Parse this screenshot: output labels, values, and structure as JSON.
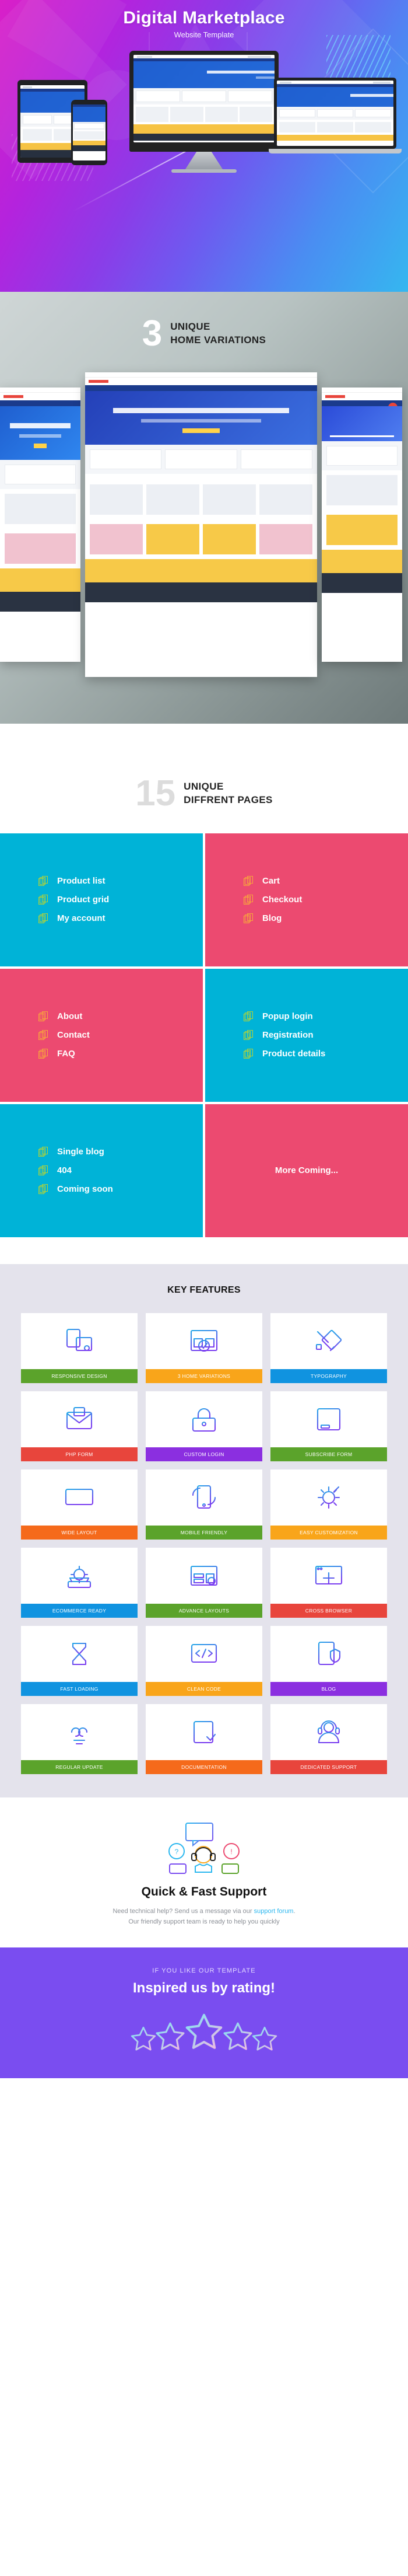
{
  "hero": {
    "title": "Digital Marketplace",
    "subtitle": "Website Template"
  },
  "variations": {
    "number": "3",
    "line1": "UNIQUE",
    "line2": "HOME VARIATIONS"
  },
  "pages": {
    "number": "15",
    "line1": "UNIQUE",
    "line2": "DIFFRENT PAGES",
    "cells": [
      {
        "bg": "cyan",
        "icon_color": "green",
        "items": [
          "Product list",
          "Product grid",
          "My account"
        ]
      },
      {
        "bg": "pink",
        "icon_color": "orange",
        "items": [
          "Cart",
          "Checkout",
          "Blog"
        ]
      },
      {
        "bg": "pink",
        "icon_color": "orange",
        "items": [
          "About",
          "Contact",
          "FAQ"
        ]
      },
      {
        "bg": "cyan",
        "icon_color": "green",
        "items": [
          "Popup login",
          "Registration",
          "Product details"
        ]
      },
      {
        "bg": "cyan",
        "icon_color": "green",
        "items": [
          "Single blog",
          "404",
          "Coming soon"
        ]
      },
      {
        "bg": "pink",
        "icon_color": "orange",
        "items": [],
        "more_text": "More Coming..."
      }
    ]
  },
  "features": {
    "title": "KEY FEATURES",
    "cards": [
      {
        "label": "RESPONSIVE DESIGN",
        "color": "#5ba32b",
        "icon": "responsive-design-icon"
      },
      {
        "label": "3 HOME VARIATIONS",
        "color": "#f9a51a",
        "icon": "home-variations-icon"
      },
      {
        "label": "TYPOGRAPHY",
        "color": "#1093e0",
        "icon": "typography-icon"
      },
      {
        "label": "PHP FORM",
        "color": "#e8453c",
        "icon": "php-form-icon"
      },
      {
        "label": "CUSTOM LOGIN",
        "color": "#8b2fe0",
        "icon": "custom-login-icon"
      },
      {
        "label": "SUBSCRIBE FORM",
        "color": "#5ba32b",
        "icon": "subscribe-form-icon"
      },
      {
        "label": "WIDE LAYOUT",
        "color": "#f56a1b",
        "icon": "wide-layout-icon"
      },
      {
        "label": "MOBILE FRIENDLY",
        "color": "#5ba32b",
        "icon": "mobile-friendly-icon"
      },
      {
        "label": "EASY CUSTOMIZATION",
        "color": "#f9a51a",
        "icon": "easy-customization-icon"
      },
      {
        "label": "ECOMMERCE READY",
        "color": "#1093e0",
        "icon": "ecommerce-ready-icon"
      },
      {
        "label": "ADVANCE LAYOUTS",
        "color": "#5ba32b",
        "icon": "advance-layouts-icon"
      },
      {
        "label": "CROSS BROWSER",
        "color": "#e8453c",
        "icon": "cross-browser-icon"
      },
      {
        "label": "FAST LOADING",
        "color": "#1093e0",
        "icon": "fast-loading-icon"
      },
      {
        "label": "CLEAN CODE",
        "color": "#f9a51a",
        "icon": "clean-code-icon"
      },
      {
        "label": "BLOG",
        "color": "#8b2fe0",
        "icon": "blog-icon"
      },
      {
        "label": "REGULAR UPDATE",
        "color": "#5ba32b",
        "icon": "regular-update-icon"
      },
      {
        "label": "DOCUMENTATION",
        "color": "#f56a1b",
        "icon": "documentation-icon"
      },
      {
        "label": "DEDICATED SUPPORT",
        "color": "#e8453c",
        "icon": "dedicated-support-icon"
      }
    ]
  },
  "support": {
    "title": "Quick & Fast Support",
    "line1_before": "Need technical help? Send us a message via our ",
    "line1_link": "support forum",
    "line1_after": ".",
    "line2": "Our friendly support team is ready to help you quickly"
  },
  "rating": {
    "kicker": "IF YOU LIKE OUR TEMPLATE",
    "title": "Inspired us by rating!",
    "star_count": "5"
  },
  "colors": {
    "cyan": "#00b3d7",
    "pink": "#ec4a70",
    "purple": "#7a4df0",
    "icon_green": "#b6d334",
    "icon_orange": "#f8a73b",
    "link_blue": "#2bb7ef"
  }
}
